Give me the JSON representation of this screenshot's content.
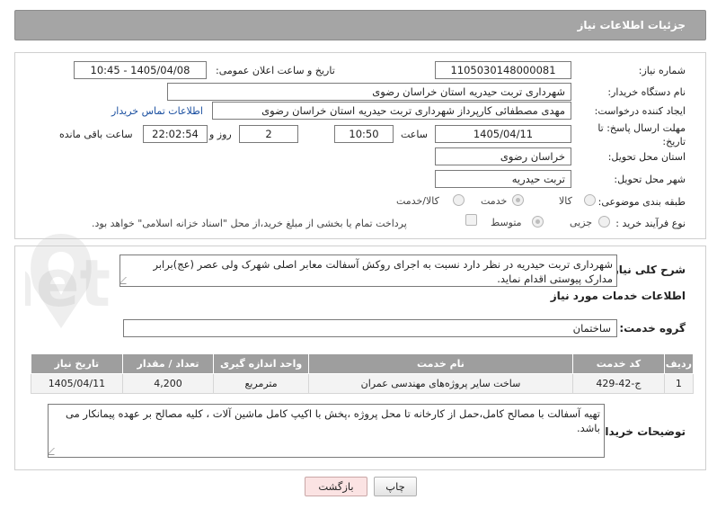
{
  "header": {
    "title": "جزئیات اطلاعات نیاز"
  },
  "labels": {
    "need_number": "شماره نیاز:",
    "announce_datetime": "تاریخ و ساعت اعلان عمومی:",
    "buyer_org": "نام دستگاه خریدار:",
    "requester": "ایجاد کننده درخواست:",
    "buyer_contact": "اطلاعات تماس خریدار",
    "deadline": "مهلت ارسال پاسخ: تا تاریخ:",
    "hour": "ساعت",
    "day_and": "روز و",
    "time_left": "ساعت باقی مانده",
    "province": "استان محل تحویل:",
    "city": "شهر محل تحویل:",
    "category": "طبقه بندی موضوعی:",
    "process_type": "نوع فرآیند خرید :",
    "summary": "شرح کلی نیاز:",
    "services_info": "اطلاعات خدمات مورد نیاز",
    "service_group": "گروه خدمت:",
    "buyer_notes": "توضیحات خریدار:"
  },
  "fields": {
    "need_number": "1105030148000081",
    "announce_datetime": "1405/04/08 - 10:45",
    "buyer_org": "شهرداری تربت حیدریه استان خراسان رضوی",
    "requester": "مهدی مصطفائی کارپرداز شهرداری تربت حیدریه استان خراسان رضوی",
    "deadline_date": "1405/04/11",
    "deadline_time": "10:50",
    "days_left": "2",
    "time_left": "22:02:54",
    "province": "خراسان رضوی",
    "city": "تربت حیدریه",
    "summary": "شهرداری تربت حیدریه در نظر دارد نسبت به اجرای روکش آسفالت معابر اصلی شهرک ولی عصر (عج)برابر مدارک پیوستی اقدام نماید.",
    "service_group": "ساختمان",
    "buyer_notes": "تهیه آسفالت با مصالح کامل،حمل از کارخانه تا محل پروژه ،پخش با اکیپ کامل ماشین آلات ، کلیه مصالح بر عهده پیمانکار می باشد."
  },
  "category_options": {
    "goods": "کالا",
    "service": "خدمت",
    "goods_service": "کالا/خدمت",
    "selected": "خدمت"
  },
  "process_options": {
    "partial": "جزیی",
    "medium": "متوسط",
    "selected": "متوسط",
    "payment_note": "پرداخت تمام یا بخشی از مبلغ خرید،از محل \"اسناد خزانه اسلامی\" خواهد بود."
  },
  "table": {
    "headers": [
      "ردیف",
      "کد خدمت",
      "نام خدمت",
      "واحد اندازه گیری",
      "تعداد / مقدار",
      "تاریخ نیاز"
    ],
    "rows": [
      [
        "1",
        "ج-42-429",
        "ساخت سایر پروژه‌های مهندسی عمران",
        "مترمربع",
        "4,200",
        "1405/04/11"
      ]
    ]
  },
  "buttons": {
    "print": "چاپ",
    "back": "بازگشت"
  },
  "watermark": {
    "text": "AriaTender.net"
  },
  "colors": {
    "header_bg": "#a5a5a5",
    "table_header_bg": "#9e9e9e",
    "back_button_bg": "#fbe3e3",
    "link": "#1a4fa0"
  }
}
